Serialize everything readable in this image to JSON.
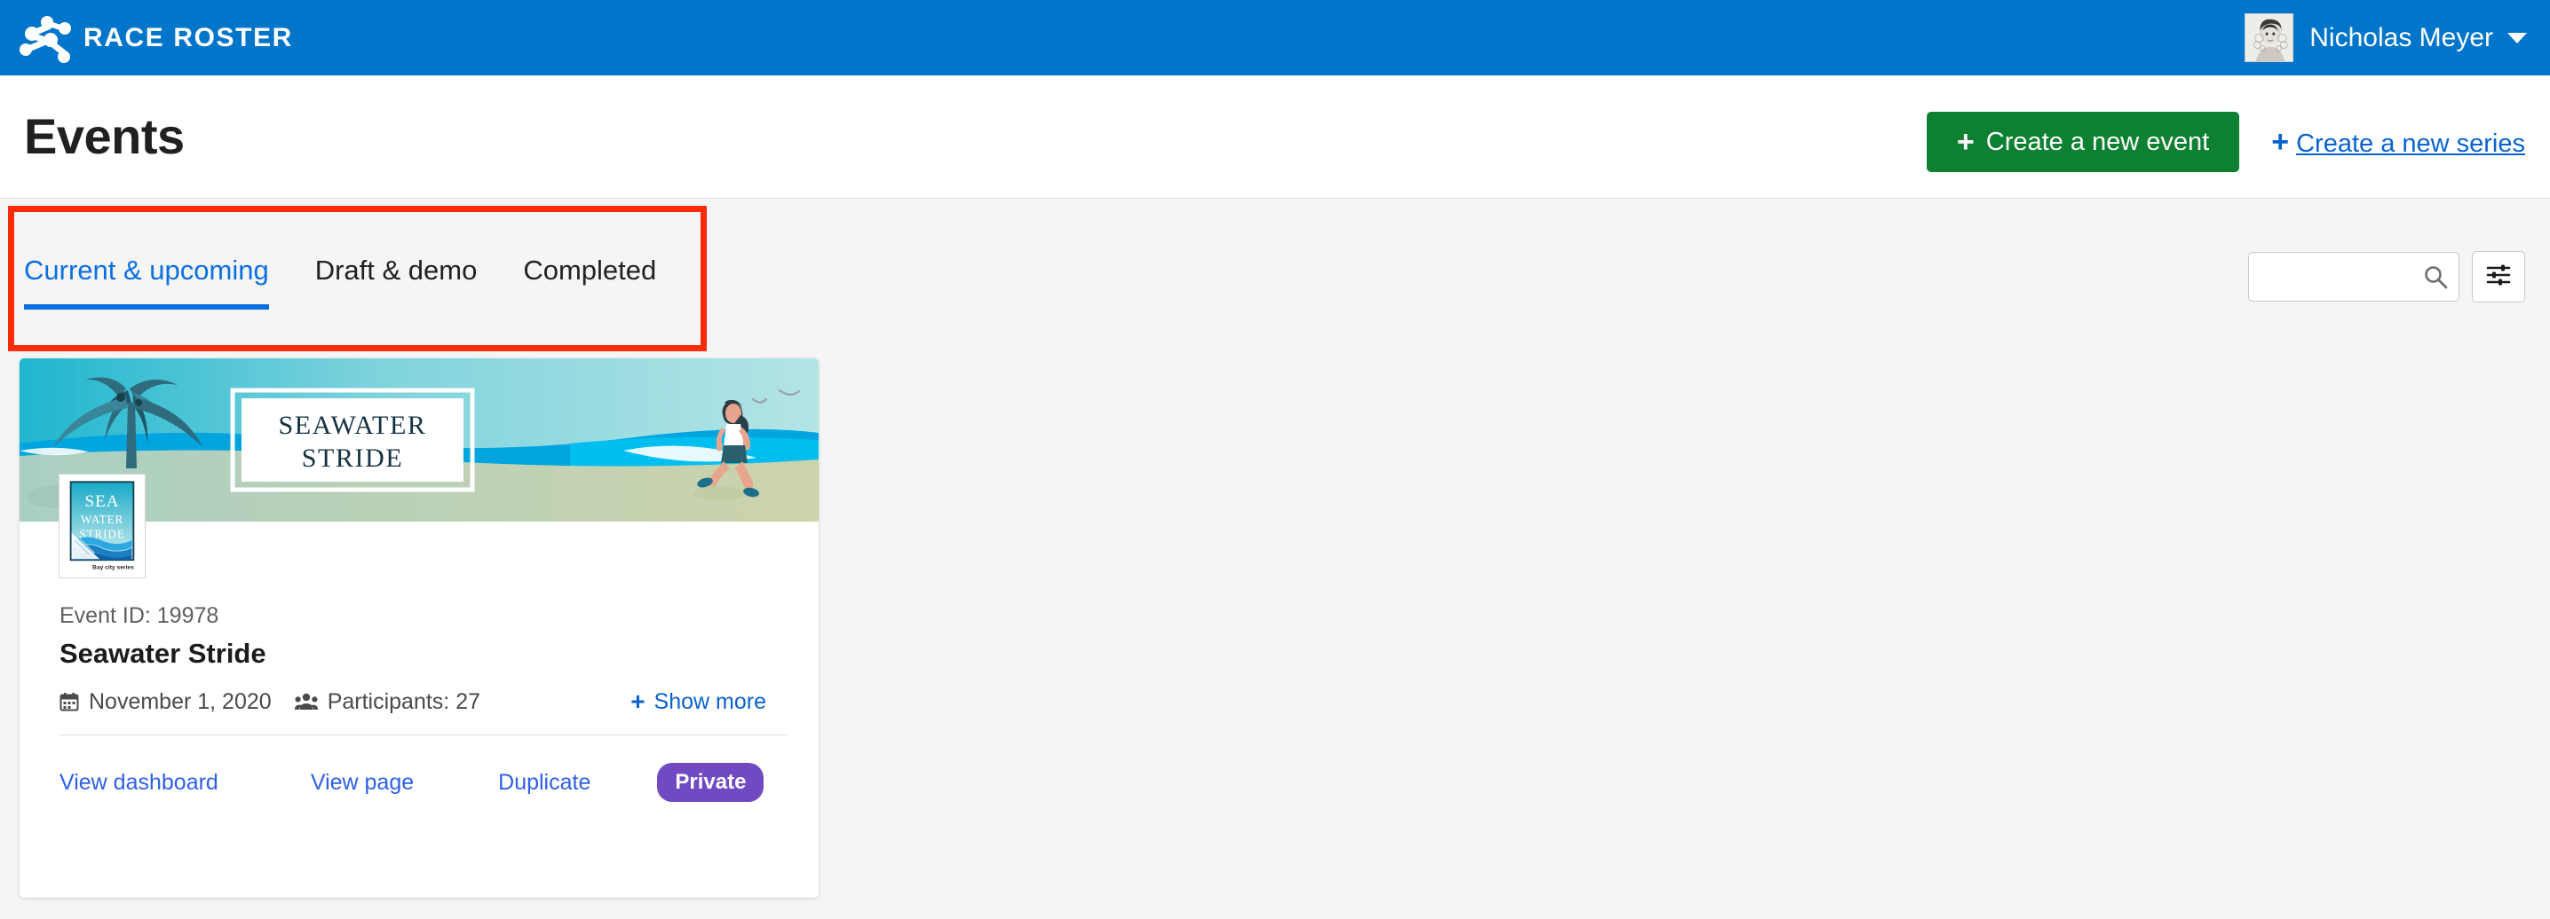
{
  "topnav": {
    "brand_text": "RACE ROSTER",
    "brand_icon": "race-roster-network-logo",
    "user_name": "Nicholas Meyer",
    "avatar_icon": "user-portrait-avatar",
    "caret_icon": "chevron-down-icon"
  },
  "header": {
    "title": "Events",
    "create_event_label": "Create a new event",
    "create_event_plus": "+",
    "create_series_label": "Create a new series",
    "create_series_plus": "+",
    "green_color": "#0e8032",
    "link_color": "#0a62d0"
  },
  "tabs": {
    "highlight_color": "#fc2b05",
    "active_color": "#0a6fe0",
    "items": [
      {
        "label": "Current & upcoming",
        "active": true
      },
      {
        "label": "Draft & demo",
        "active": false
      },
      {
        "label": "Completed",
        "active": false
      }
    ]
  },
  "search": {
    "value": "",
    "placeholder": "",
    "search_icon": "search-icon",
    "filter_icon": "sliders-filter-icon"
  },
  "event_card": {
    "banner": {
      "title_line1": "SEAWATER",
      "title_line2": "STRIDE",
      "scene": "beach-palm-ocean-runner-illustration",
      "sky_color": "#b4e4e6",
      "ocean_color": "#00bff0",
      "sand_color": "#cdd3ab",
      "palm_color": "#2d6b7d",
      "title_color": "#143241"
    },
    "logo": {
      "line1": "SEA",
      "line2": "WATER",
      "line3": "STRIDE",
      "caption": "Bay city series",
      "icon": "seawater-stride-event-logo"
    },
    "event_id_label": "Event ID: 19978",
    "event_name": "Seawater Stride",
    "date_icon": "calendar-icon",
    "date": "November 1, 2020",
    "participants_icon": "people-group-icon",
    "participants": "Participants: 27",
    "show_more_plus": "+",
    "show_more_label": "Show more",
    "footer_links": [
      {
        "label": "View dashboard"
      },
      {
        "label": "View page"
      },
      {
        "label": "Duplicate"
      }
    ],
    "status_badge": "Private",
    "badge_color": "#7049c3"
  }
}
